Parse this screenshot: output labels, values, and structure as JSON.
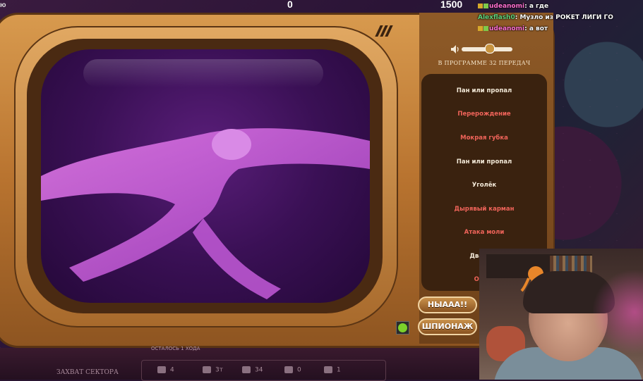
{
  "top": {
    "counter_left": "0",
    "counter_right": "1500",
    "corner_text": "ю"
  },
  "chat": [
    {
      "user": "udeanomi",
      "user_class": "pink",
      "text": ": а где"
    },
    {
      "user": "Alexflash0",
      "user_class": "green",
      "text": ": Музло из РОКЕТ ЛИГИ ГО"
    },
    {
      "user": "udeanomi",
      "user_class": "pink",
      "text": ": а вот"
    }
  ],
  "panel": {
    "program_title": "В ПРОГРАММЕ 32 ПЕРЕДАЧ",
    "items": [
      {
        "label": "Пан или пропал",
        "color": "#f4ead9"
      },
      {
        "label": "Перерождение",
        "color": "#f0645a"
      },
      {
        "label": "Мокрая губка",
        "color": "#f0645a"
      },
      {
        "label": "Пан или пропал",
        "color": "#f4ead9"
      },
      {
        "label": "Уголёк",
        "color": "#f4ead9"
      },
      {
        "label": "Дырявый карман",
        "color": "#f0645a"
      },
      {
        "label": "Атака моли",
        "color": "#f0645a"
      },
      {
        "label": "Два по с",
        "color": "#f4ead9"
      },
      {
        "label": "Опять",
        "color": "#f0645a"
      }
    ],
    "buttons": {
      "nyaaa": "НЫААА!!",
      "spy": "ШПИОНАЖ"
    },
    "volume": 0.55
  },
  "bottom": {
    "zahvat": "ЗАХВАТ СЕКТОРА",
    "ostalos": "ОСТАЛОСЬ 1 ХОДА",
    "stats": [
      {
        "icon": "heart-icon",
        "value": "4"
      },
      {
        "icon": "gem-icon",
        "value": "3т"
      },
      {
        "icon": "coin-icon",
        "value": "34"
      },
      {
        "icon": "boot-icon",
        "value": "0"
      },
      {
        "icon": "lamp-icon",
        "value": "1"
      }
    ]
  },
  "colors": {
    "accent_pink": "#ff6fd0",
    "accent_green": "#5fd27c",
    "tv_wood": "#b8732f",
    "list_red": "#f0645a"
  }
}
